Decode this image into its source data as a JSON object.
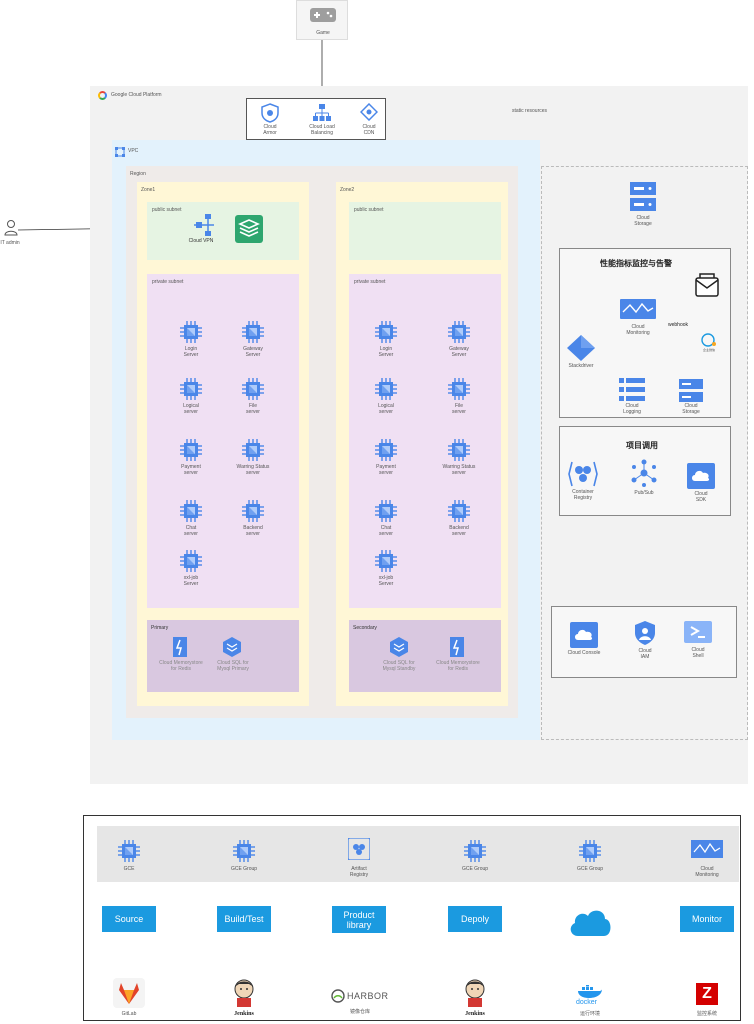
{
  "game": {
    "label": "Game"
  },
  "gcp": {
    "label": "Google Cloud Platform"
  },
  "edge": {
    "armor": "Cloud\nArmor",
    "lb": "Cloud Load\nBalancing",
    "cdn": "Cloud\nCDN"
  },
  "static_resources": "static resources",
  "vpc": "VPC",
  "region": "Region",
  "zone1": "Zone1",
  "zone2": "Zone2",
  "public_subnet": "public subnet",
  "private_subnet": "private subnet",
  "it_admin": "IT admin",
  "cloud_vpn": "Cloud VPN",
  "servers": [
    "Login\nServer",
    "Gateway\nServer",
    "Logical\nserver",
    "File\nserver",
    "Payment\nserver",
    "Warring Status\nserver",
    "Chat\nserver",
    "Backend\nserver",
    "xxl-job\nServer"
  ],
  "primary": {
    "label": "Primary",
    "memorystore": "Cloud Memorystore\nfor Redis",
    "sql": "Cloud SQL for\nMysql Primary"
  },
  "secondary": {
    "label": "Secondary",
    "sql": "Cloud SQL for\nMysql Standby",
    "memorystore": "Cloud Memorystore\nfor Redis"
  },
  "cloud_storage": "Cloud\nStorage",
  "monitoring_panel": {
    "title": "性能指标监控与告警",
    "stackdriver": "Stackdriver",
    "monitoring": "Cloud\nMonitoring",
    "webhook": "webhook",
    "logging": "Cloud\nLogging",
    "storage": "Cloud\nStorage",
    "wechat": "企业微信"
  },
  "project_panel": {
    "title": "项目调用",
    "registry": "Container\nRegistry",
    "pubsub": "Pub/Sub",
    "sdk": "Cloud\nSDK"
  },
  "tools_panel": {
    "console": "Cloud Console",
    "iam": "Cloud\nIAM",
    "shell": "Cloud\nShell"
  },
  "pipeline": {
    "infra": [
      "GCE",
      "GCE Group",
      "Artifact\nRegistry",
      "GCE Group",
      "GCE Group",
      "Cloud\nMonitoring"
    ],
    "stages": [
      "Source",
      "Build/Test",
      "Product\nlibrary",
      "Depoly",
      "",
      "Monitor"
    ],
    "tools": [
      "GitLab",
      "Jenkins",
      "镜像仓库",
      "Jenkins",
      "运行环境",
      "监控系统"
    ],
    "tool_marks": {
      "harbor": "HARBOR",
      "docker": "docker",
      "zabbix": "Z"
    }
  },
  "colors": {
    "gcp_bg": "#f2f2f2",
    "vpc_bg": "#e3f2fc",
    "region_bg": "#efebe9",
    "zone_bg": "#fff7d6",
    "public_bg": "#e6f4e3",
    "private_bg": "#f0e0f3",
    "db_bg": "#d9c8e0",
    "accent": "#1b9ae0",
    "chip": "#4a86e8"
  }
}
